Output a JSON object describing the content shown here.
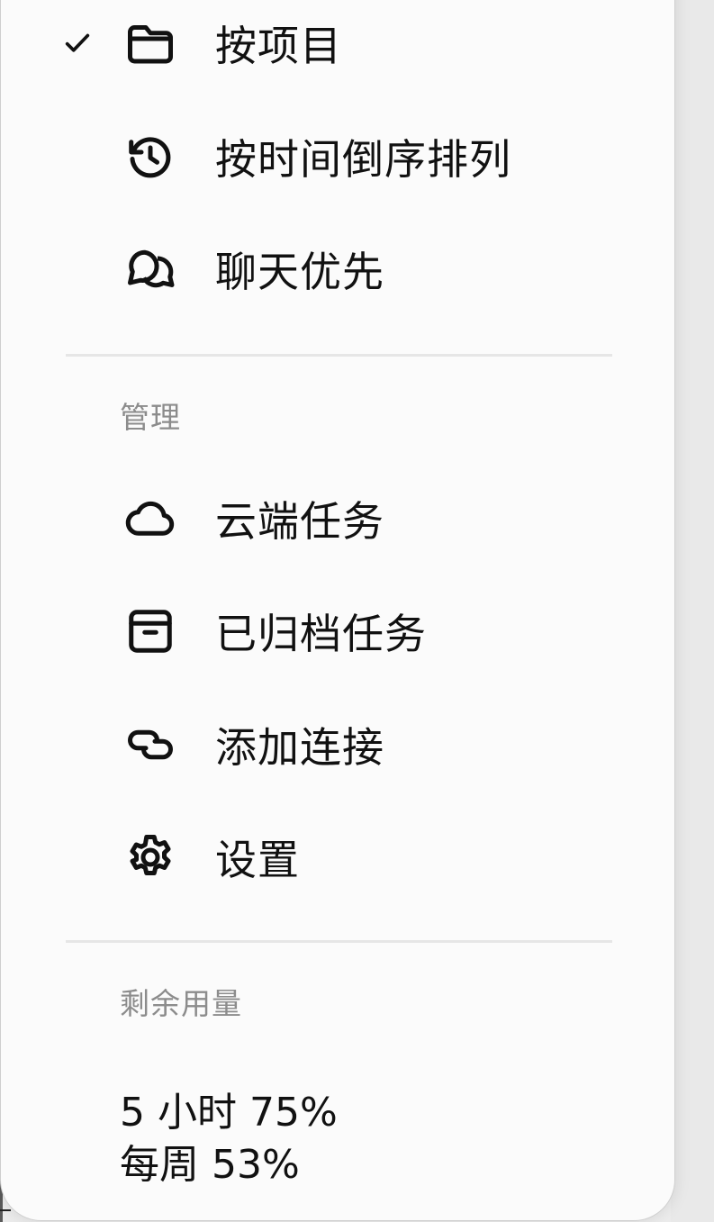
{
  "menu": {
    "sort_items": [
      {
        "label": "按项目",
        "icon": "folder-icon",
        "checked": true
      },
      {
        "label": "按时间倒序排列",
        "icon": "history-icon",
        "checked": false
      },
      {
        "label": "聊天优先",
        "icon": "chat-bubbles-icon",
        "checked": false
      }
    ],
    "manage": {
      "title": "管理",
      "items": [
        {
          "label": "云端任务",
          "icon": "cloud-icon"
        },
        {
          "label": "已归档任务",
          "icon": "archive-icon"
        },
        {
          "label": "添加连接",
          "icon": "link-icon"
        },
        {
          "label": "设置",
          "icon": "gear-icon"
        }
      ]
    },
    "usage": {
      "title": "剩余用量",
      "five_hour": "5 小时 75%",
      "weekly": "每周 53%"
    }
  }
}
